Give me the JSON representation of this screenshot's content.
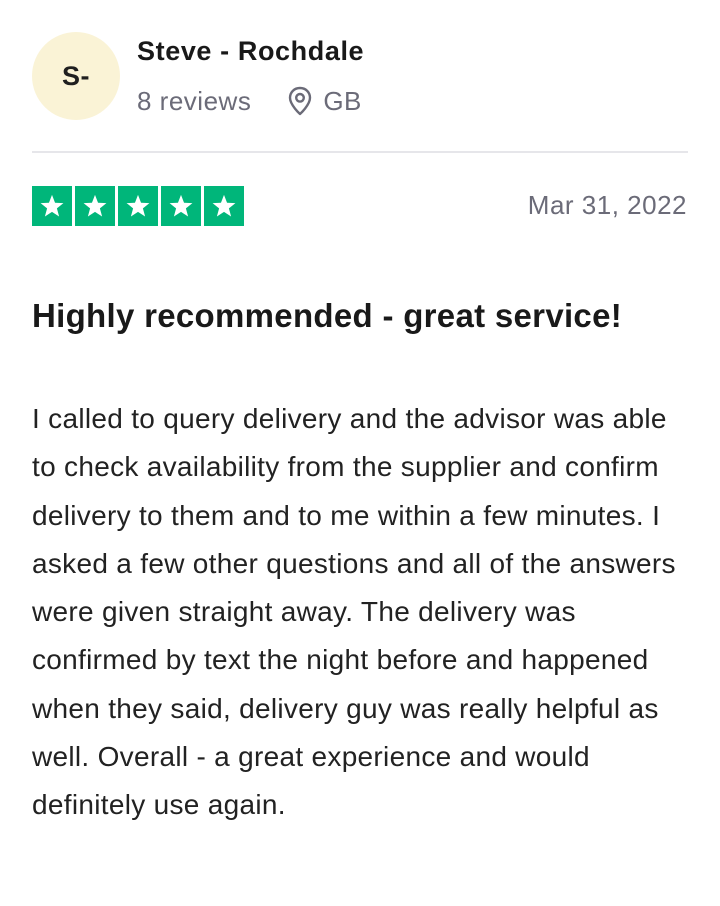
{
  "reviewer": {
    "initials": "S-",
    "name": "Steve - Rochdale",
    "reviews": "8 reviews",
    "country": "GB",
    "avatar_color": "#faf3d6"
  },
  "rating": {
    "stars": 5,
    "max_stars": 5,
    "star_color": "#00b67a",
    "icon": "star-icon"
  },
  "date": "Mar 31, 2022",
  "review": {
    "title": "Highly recommended - great service!",
    "body": "I called to query delivery and the advisor was able to check availability from the supplier and confirm delivery to them and to me within a few minutes. I asked a few other questions and all of the answers were given straight away. The delivery was confirmed by text the night before and happened when they said, delivery guy was really helpful as well. Overall - a great experience and would definitely use again."
  }
}
